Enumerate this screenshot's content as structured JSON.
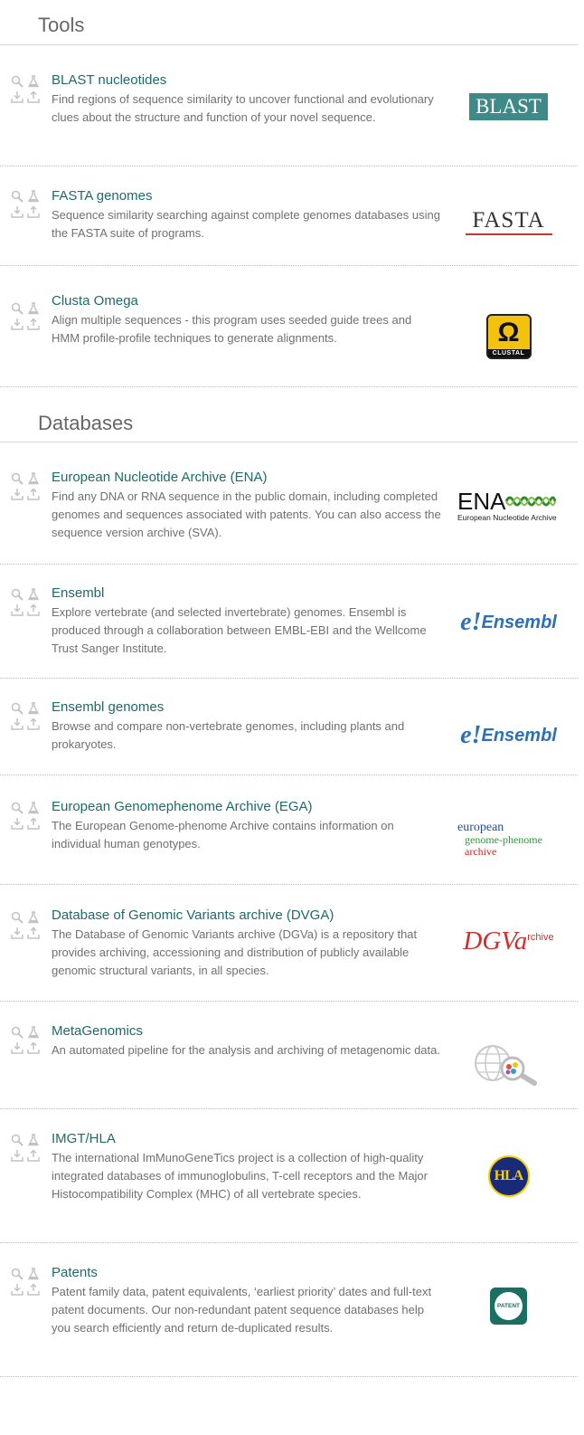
{
  "sections": {
    "tools_title": "Tools",
    "databases_title": "Databases"
  },
  "tools": [
    {
      "title": "BLAST nucleotides",
      "desc": "Find regions of sequence similarity to uncover functional and evolutionary clues about the structure and function of your novel sequence.",
      "logo_text": "BLAST"
    },
    {
      "title": "FASTA genomes",
      "desc": "Sequence similarity searching against complete genomes databases using the FASTA suite of programs.",
      "logo_text": "FASTA"
    },
    {
      "title": "Clusta Omega",
      "desc": "Align multiple sequences - this program uses seeded guide trees and HMM profile-profile techniques to generate alignments.",
      "logo_text": "CLUSTAL",
      "logo_symbol": "Ω"
    }
  ],
  "databases": [
    {
      "title": "European Nucleotide Archive (ENA)",
      "desc": "Find any DNA or RNA sequence in the public domain, including completed genomes and sequences associated with patents. You can also access the sequence version archive (SVA).",
      "logo_text": "ENA",
      "logo_sub": "European Nucleotide Archive"
    },
    {
      "title": "Ensembl",
      "desc": "Explore vertebrate (and selected invertebrate) genomes. Ensembl is produced through a collaboration between EMBL-EBI and the Wellcome Trust Sanger Institute.",
      "logo_mark": "e!",
      "logo_text": "Ensembl"
    },
    {
      "title": "Ensembl genomes",
      "desc": "Browse and compare non-vertebrate genomes, including plants and prokaryotes.",
      "logo_mark": "e!",
      "logo_text": "Ensembl"
    },
    {
      "title": "European Genomephenome Archive (EGA)",
      "desc": "The European Genome-phenome Archive contains information on individual human genotypes.",
      "logo_line1": "european",
      "logo_line2": "genome-phenome",
      "logo_line3": "archive"
    },
    {
      "title": "Database of Genomic Variants archive (DVGA)",
      "desc": "The Database of Genomic Variants archive (DGVa) is a repository that provides archiving, accessioning and distribution of publicly available genomic structural variants, in all species.",
      "logo_text": "DGVa",
      "logo_sub": "rchive"
    },
    {
      "title": "MetaGenomics",
      "desc": "An automated pipeline for the analysis and archiving of metagenomic data."
    },
    {
      "title": "IMGT/HLA",
      "desc": "The international ImMunoGeneTics project is a collection of high-quality integrated databases of immunoglobulins, T-cell receptors and the Major Histocompatibility Complex (MHC) of all vertebrate species.",
      "logo_text": "HLA"
    },
    {
      "title": "Patents",
      "desc": "Patent family data, patent equivalents, ‘earliest priority’ dates and full-text patent documents. Our non-redundant patent sequence databases help you search efficiently and return de-duplicated results.",
      "logo_text": "PATENT"
    }
  ],
  "colors": {
    "title_link": "#1d6a6a",
    "blast_bg": "#3e8a88",
    "ensembl_blue": "#2f6fb8",
    "ensembl_red": "#d9242a",
    "dgva_red": "#d62b2b",
    "patent_green": "#1a6e62"
  },
  "row_icons": [
    "search-icon",
    "flask-icon",
    "download-icon",
    "upload-icon"
  ]
}
